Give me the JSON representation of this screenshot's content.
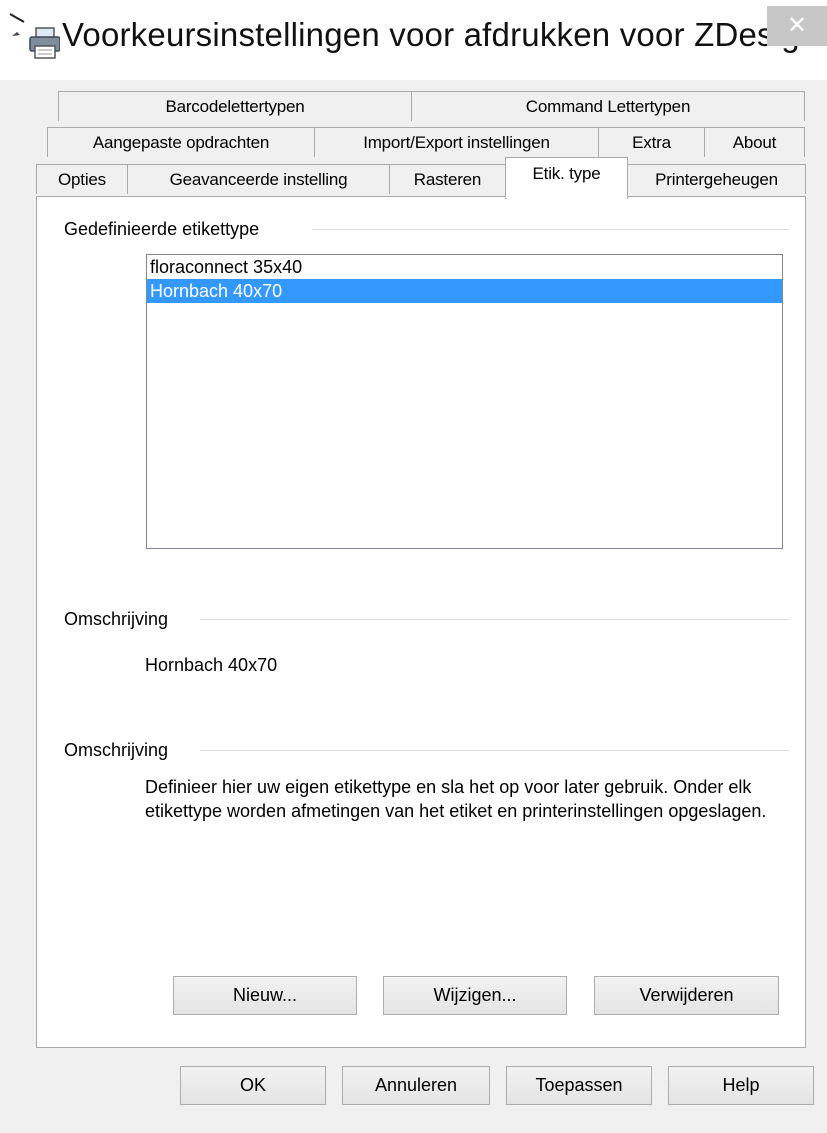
{
  "window": {
    "title": "Voorkeursinstellingen voor afdrukken voor ZDesig...",
    "close_label": "✕",
    "icon": "printer-icon"
  },
  "tabs": {
    "row1": [
      {
        "label": "Barcodelettertypen"
      },
      {
        "label": "Command Lettertypen"
      }
    ],
    "row2": [
      {
        "label": "Aangepaste opdrachten"
      },
      {
        "label": "Import/Export instellingen"
      },
      {
        "label": "Extra"
      },
      {
        "label": "About"
      }
    ],
    "row3": [
      {
        "label": "Opties"
      },
      {
        "label": "Geavanceerde instelling"
      },
      {
        "label": "Rasteren"
      },
      {
        "label": "Etik. type",
        "selected": true
      },
      {
        "label": "Printergeheugen"
      }
    ]
  },
  "panel": {
    "defined_group_title": "Gedefinieerde etikettype",
    "label_types": [
      "floraconnect 35x40",
      "Hornbach 40x70"
    ],
    "selected_index": 1,
    "description_group_title": "Omschrijving",
    "description_value": "Hornbach 40x70",
    "info_group_title": "Omschrijving",
    "info_text": "Definieer hier uw eigen etikettype en sla het op voor later gebruik. Onder elk etikettype worden afmetingen van het etiket en printerinstellingen opgeslagen.",
    "buttons": {
      "new": "Nieuw...",
      "edit": "Wijzigen...",
      "delete": "Verwijderen"
    }
  },
  "footer_buttons": {
    "ok": "OK",
    "cancel": "Annuleren",
    "apply": "Toepassen",
    "help": "Help"
  },
  "colors": {
    "selection": "#3399ff",
    "close_button": "#c7c7c7"
  }
}
